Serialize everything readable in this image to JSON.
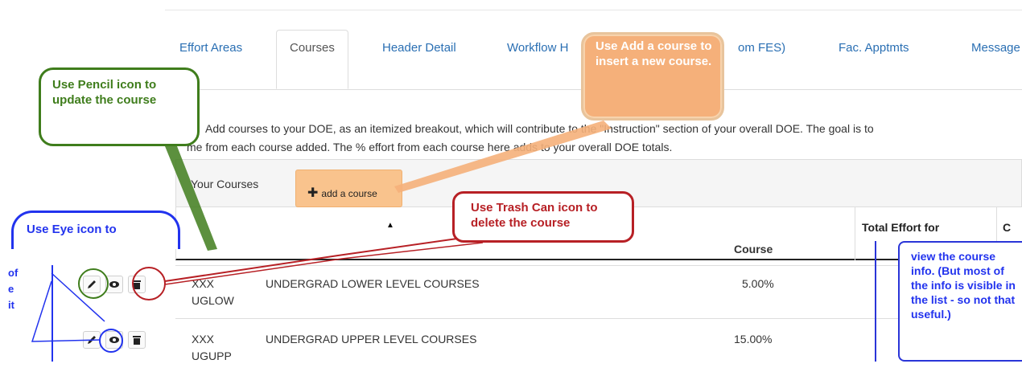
{
  "tabs": [
    {
      "label": "Effort Areas"
    },
    {
      "label": "Courses"
    },
    {
      "label": "Header Detail"
    },
    {
      "label": "Workflow H"
    },
    {
      "label": "om FES)"
    },
    {
      "label": "Fac. Apptmts"
    },
    {
      "label": "Message"
    }
  ],
  "description": {
    "line1": "Add courses to your DOE, as an itemized breakout, which will contribute to the \"Instruction\" section of your overall DOE. The goal is to",
    "line2": "me from each course added. The % effort from each course here adds to your overall DOE totals."
  },
  "panel": {
    "title": "Your Courses",
    "add_button": "add a course"
  },
  "table": {
    "headers": {
      "course": "Course",
      "total_effort": "Total Effort for",
      "next_col": "C"
    },
    "rows": [
      {
        "code_line1": "XXX",
        "code_line2": "UGLOW",
        "name": "UNDERGRAD LOWER LEVEL COURSES",
        "percent": "5.00%"
      },
      {
        "code_line1": "XXX",
        "code_line2": "UGUPP",
        "name": "UNDERGRAD UPPER LEVEL COURSES",
        "percent": "15.00%"
      }
    ]
  },
  "callouts": {
    "pencil": "Use Pencil icon to update the course",
    "add": "Use Add a course to insert a new course.",
    "trash": "Use Trash Can icon to delete the course",
    "eye": "Use Eye icon to",
    "eye_right": "view the course info. (But most of the info is visible in the list - so not that useful.)"
  },
  "left_fragments": [
    "of",
    "e",
    "it"
  ],
  "colors": {
    "link": "#2a6fb3",
    "add_button_bg": "#f9c38d",
    "pencil_callout": "#3f7d1c",
    "add_callout": "#f5b07a",
    "trash_callout": "#b72025",
    "eye_callout": "#2233ee"
  },
  "icons": [
    "pencil-icon",
    "eye-icon",
    "trash-icon",
    "plus-icon",
    "sort-caret-icon"
  ]
}
